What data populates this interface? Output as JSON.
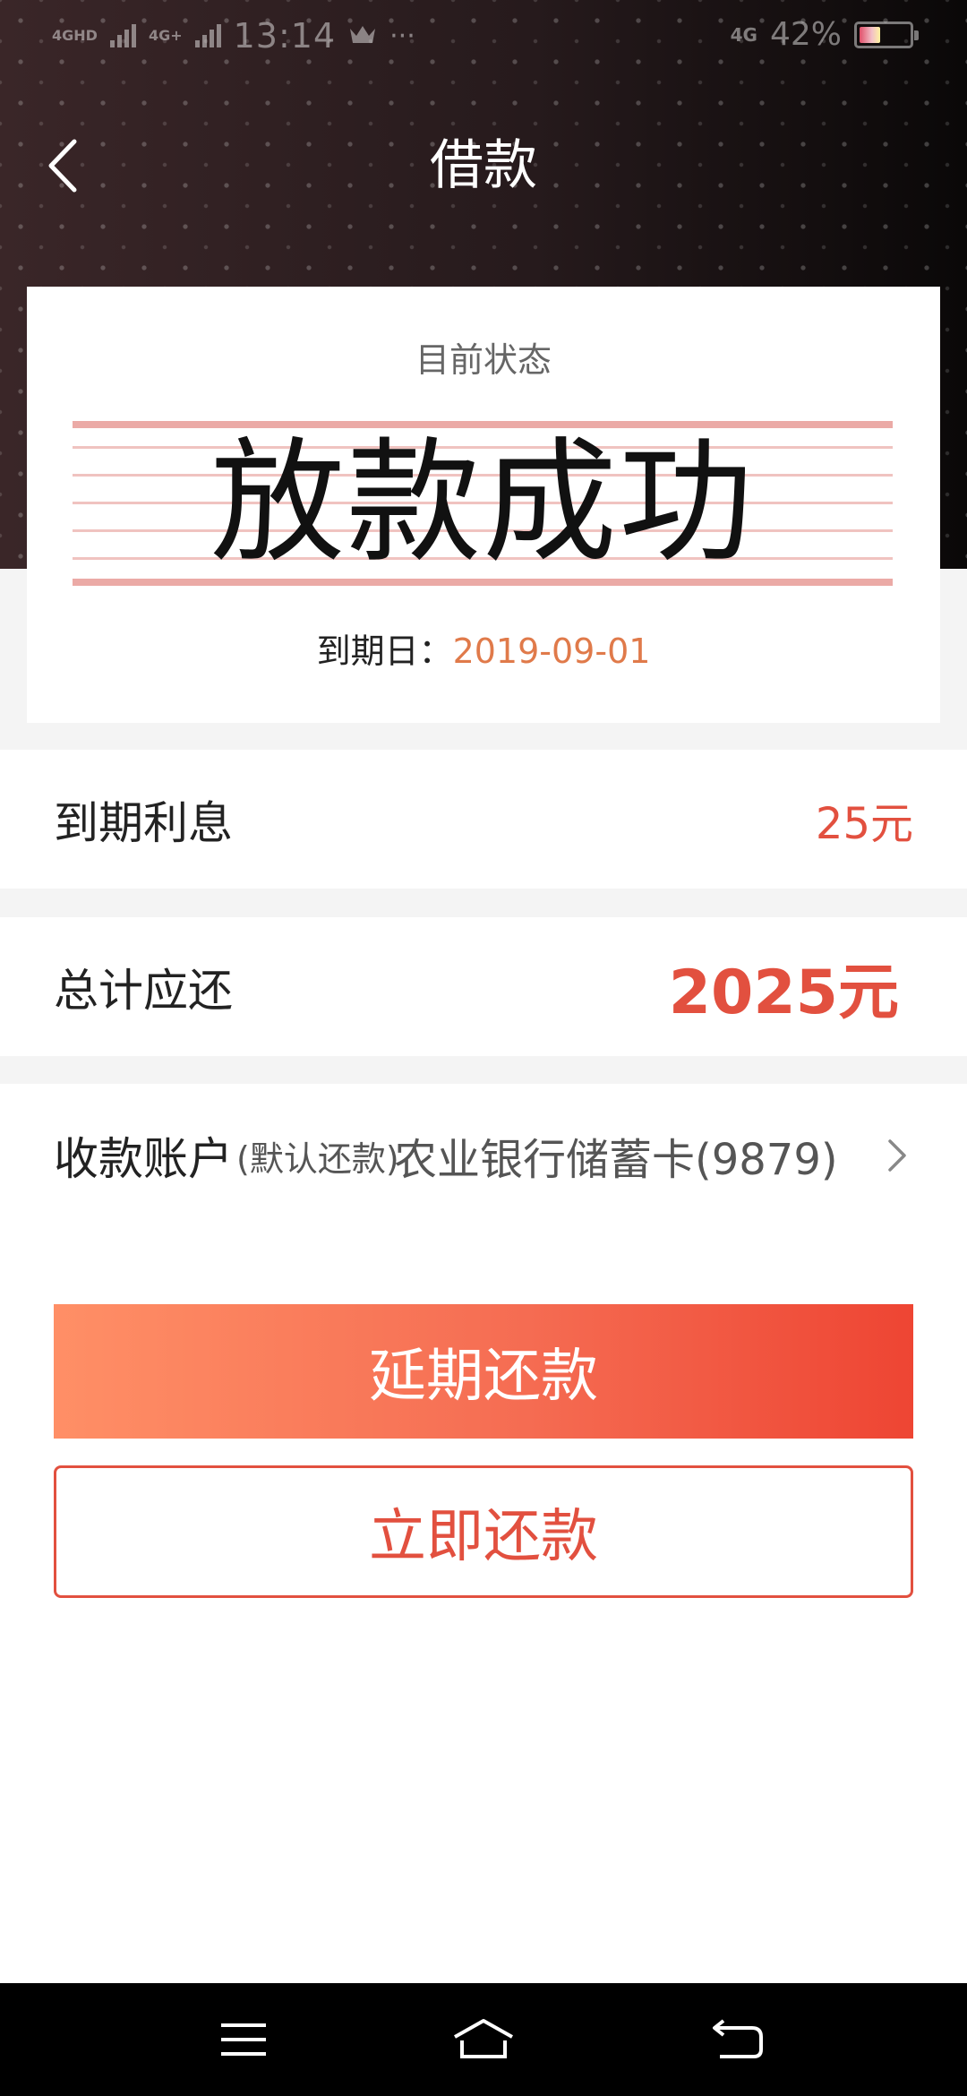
{
  "status_bar": {
    "network_1": "4GHD",
    "network_2": "4G+",
    "time": "13:14",
    "extra": "···",
    "network_right": "4G",
    "battery": "42%"
  },
  "nav": {
    "title": "借款"
  },
  "status_card": {
    "label": "目前状态",
    "stamp": "放款成功",
    "due_label": "到期日：",
    "due_value": "2019-09-01"
  },
  "rows": {
    "interest_label": "到期利息",
    "interest_value": "25元",
    "total_label": "总计应还",
    "total_value": "2025元"
  },
  "account": {
    "label": "收款账户",
    "note": "(默认还款)",
    "value": "农业银行储蓄卡(9879)"
  },
  "buttons": {
    "extend": "延期还款",
    "repay_now": "立即还款"
  },
  "colors": {
    "accent": "#e2503f",
    "due_date": "#e07a4a"
  },
  "icons": {
    "back": "back-arrow-icon",
    "chevron": "chevron-right-icon",
    "menu": "menu-icon",
    "home": "home-icon",
    "return": "return-icon"
  }
}
